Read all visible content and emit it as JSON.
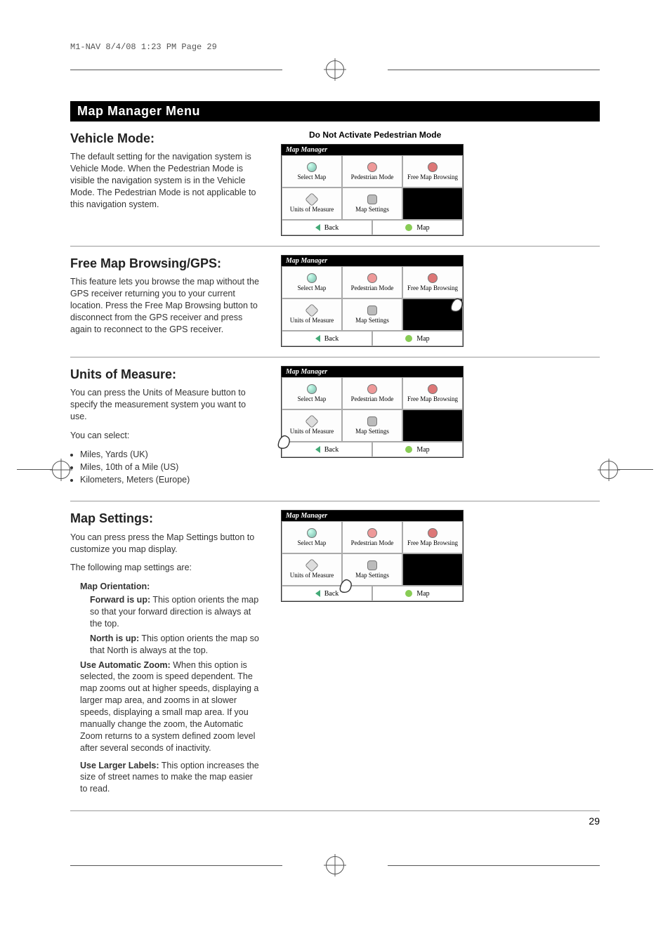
{
  "header": "M1-NAV  8/4/08  1:23 PM  Page 29",
  "page_number": "29",
  "section_bar": "Map Manager Menu",
  "sections": {
    "vehicle": {
      "heading": "Vehicle Mode:",
      "body": "The default setting for the navigation system is Vehicle Mode. When the Pedestrian Mode is visible the navigation system is in the Vehicle Mode. The Pedestrian Mode is not applicable to this navigation system.",
      "caption": "Do Not Activate Pedestrian Mode"
    },
    "freemap": {
      "heading": "Free Map Browsing/GPS:",
      "body": "This feature lets you browse the map without the GPS receiver returning you to your current location. Press the Free Map Browsing button to disconnect from the GPS receiver and press again to reconnect to the GPS receiver."
    },
    "units": {
      "heading": "Units of Measure:",
      "body": "You can press the Units of Measure button to specify the measurement system you want to use.",
      "select_intro": "You can select:",
      "options": [
        "Miles, Yards (UK)",
        "Miles, 10th of a Mile (US)",
        "Kilometers, Meters (Europe)"
      ]
    },
    "mapsettings": {
      "heading": "Map Settings:",
      "body": "You can press press the Map Settings button to customize you map display.",
      "intro": "The following map settings are:",
      "orient_title": "Map Orientation:",
      "forward_label": "Forward is up:",
      "forward_text": " This option orients the map so that your forward direction is always at the top.",
      "north_label": "North is up:",
      "north_text": " This option orients the map so that North is always at the top.",
      "zoom_label": "Use Automatic Zoom:",
      "zoom_text": " When this option is selected, the zoom is speed dependent. The map zooms out at higher speeds, displaying a larger map area, and zooms in at slower speeds, displaying a small map area. If you manually change the zoom, the Automatic Zoom returns to a system defined zoom level after several seconds of inactivity.",
      "labels_label": "Use Larger Labels:",
      "labels_text": " This option increases the size of street names to make the map easier to read."
    }
  },
  "mm": {
    "title": "Map Manager",
    "select_map": "Select Map",
    "pedestrian": "Pedestrian Mode",
    "free_browse": "Free Map Browsing",
    "units": "Units of Measure",
    "settings": "Map Settings",
    "back": "Back",
    "map": "Map"
  }
}
